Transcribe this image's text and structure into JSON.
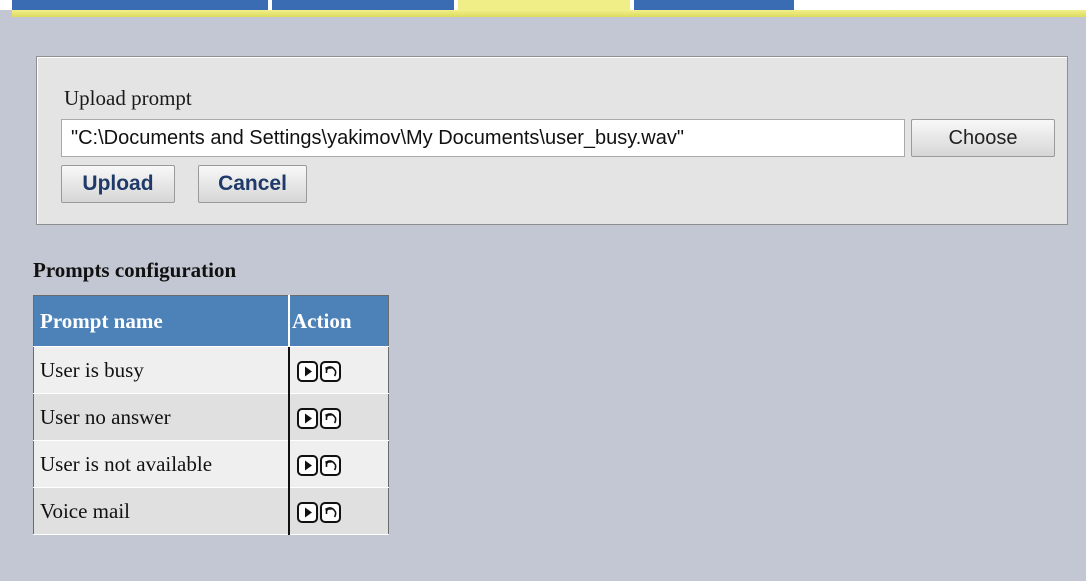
{
  "upload": {
    "label": "Upload prompt",
    "file_path": "\"C:\\Documents and Settings\\yakimov\\My Documents\\user_busy.wav\"",
    "choose_label": "Choose",
    "upload_label": "Upload",
    "cancel_label": "Cancel"
  },
  "prompts": {
    "title": "Prompts configuration",
    "columns": [
      "Prompt name",
      "Action"
    ],
    "rows": [
      {
        "name": "User is busy",
        "actions": [
          "play-icon",
          "reset-icon"
        ]
      },
      {
        "name": "User no answer",
        "actions": [
          "play-icon",
          "reset-icon"
        ]
      },
      {
        "name": "User is not available",
        "actions": [
          "play-icon",
          "reset-icon"
        ]
      },
      {
        "name": "Voice mail",
        "actions": [
          "play-icon",
          "reset-icon"
        ]
      }
    ]
  },
  "colors": {
    "page_background": "#c3c7d3",
    "header_blue": "#4c82b7",
    "tab_blue": "#3a6cb4",
    "accent_yellow": "#f0ee86",
    "button_text": "#1f3a68"
  }
}
